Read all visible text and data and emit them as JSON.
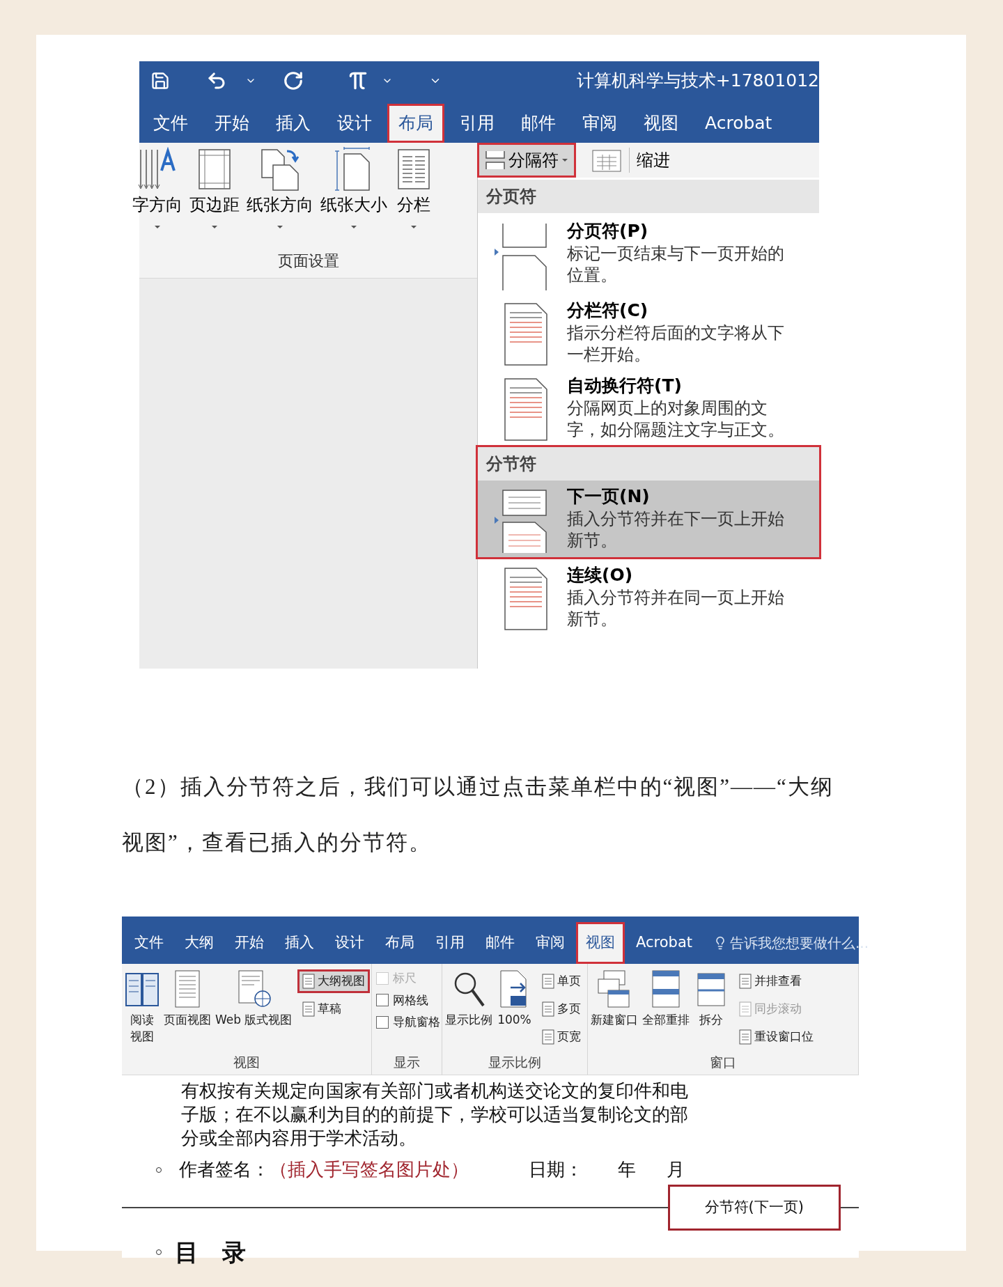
{
  "top_screenshot": {
    "title": "计算机科学与技术+17801012",
    "tabs": [
      {
        "label": "文件",
        "selected": false,
        "highlighted": false
      },
      {
        "label": "开始",
        "selected": false,
        "highlighted": false
      },
      {
        "label": "插入",
        "selected": false,
        "highlighted": false
      },
      {
        "label": "设计",
        "selected": false,
        "highlighted": false
      },
      {
        "label": "布局",
        "selected": true,
        "highlighted": true
      },
      {
        "label": "引用",
        "selected": false,
        "highlighted": false
      },
      {
        "label": "邮件",
        "selected": false,
        "highlighted": false
      },
      {
        "label": "审阅",
        "selected": false,
        "highlighted": false
      },
      {
        "label": "视图",
        "selected": false,
        "highlighted": false
      },
      {
        "label": "Acrobat",
        "selected": false,
        "highlighted": false
      }
    ],
    "page_setup": {
      "group_label": "页面设置",
      "buttons": [
        "字方向",
        "页边距",
        "纸张方向",
        "纸张大小",
        "分栏"
      ]
    },
    "breaks_button": {
      "label": "分隔符",
      "highlighted": true
    },
    "indent_label": "缩进",
    "breaks_menu": [
      {
        "heading": "分页符",
        "highlighted": false,
        "items": [
          {
            "title": "分页符(P)",
            "description": "标记一页结束与下一页开始的位置。",
            "selected": false,
            "highlighted": false
          },
          {
            "title": "分栏符(C)",
            "description": "指示分栏符后面的文字将从下一栏开始。",
            "selected": false,
            "highlighted": false
          },
          {
            "title": "自动换行符(T)",
            "description": "分隔网页上的对象周围的文字，如分隔题注文字与正文。",
            "selected": false,
            "highlighted": false
          }
        ]
      },
      {
        "heading": "分节符",
        "highlighted": true,
        "items": [
          {
            "title": "下一页(N)",
            "description": "插入分节符并在下一页上开始新节。",
            "selected": true,
            "highlighted": true
          },
          {
            "title": "连续(O)",
            "description": "插入分节符并在同一页上开始新节。",
            "selected": false,
            "highlighted": false
          }
        ]
      }
    ]
  },
  "instruction": "（2）插入分节符之后，我们可以通过点击菜单栏中的“视图”——“大纲视图”，查看已插入的分节符。",
  "bottom_screenshot": {
    "tabs": [
      {
        "label": "文件",
        "selected": false,
        "highlighted": false
      },
      {
        "label": "大纲",
        "selected": false,
        "highlighted": false
      },
      {
        "label": "开始",
        "selected": false,
        "highlighted": false
      },
      {
        "label": "插入",
        "selected": false,
        "highlighted": false
      },
      {
        "label": "设计",
        "selected": false,
        "highlighted": false
      },
      {
        "label": "布局",
        "selected": false,
        "highlighted": false
      },
      {
        "label": "引用",
        "selected": false,
        "highlighted": false
      },
      {
        "label": "邮件",
        "selected": false,
        "highlighted": false
      },
      {
        "label": "审阅",
        "selected": false,
        "highlighted": false
      },
      {
        "label": "视图",
        "selected": true,
        "highlighted": true
      },
      {
        "label": "Acrobat",
        "selected": false,
        "highlighted": false
      }
    ],
    "tell_me": "告诉我您想要做什么...",
    "groups": [
      {
        "label": "视图",
        "items": [
          {
            "kind": "large",
            "label": "阅读视图",
            "selected": false,
            "disabled": false
          },
          {
            "kind": "large",
            "label": "页面视图",
            "selected": false,
            "disabled": false
          },
          {
            "kind": "large",
            "label": "Web 版式视图",
            "selected": false,
            "disabled": false
          },
          {
            "kind": "small",
            "label": "大纲视图",
            "selected": true,
            "highlighted": true,
            "disabled": false
          },
          {
            "kind": "small",
            "label": "草稿",
            "selected": false,
            "highlighted": false,
            "disabled": false
          }
        ]
      },
      {
        "label": "显示",
        "items": [
          {
            "kind": "check",
            "label": "标尺",
            "checked": false,
            "disabled": true
          },
          {
            "kind": "check",
            "label": "网格线",
            "checked": false,
            "disabled": false
          },
          {
            "kind": "check",
            "label": "导航窗格",
            "checked": false,
            "disabled": false
          }
        ]
      },
      {
        "label": "显示比例",
        "items": [
          {
            "kind": "large",
            "label": "显示比例",
            "disabled": false
          },
          {
            "kind": "large",
            "label": "100%",
            "disabled": false
          },
          {
            "kind": "small",
            "label": "单页",
            "disabled": false
          },
          {
            "kind": "small",
            "label": "多页",
            "disabled": false
          },
          {
            "kind": "small",
            "label": "页宽",
            "disabled": false
          }
        ]
      },
      {
        "label": "窗口",
        "items": [
          {
            "kind": "large",
            "label": "新建窗口",
            "disabled": false
          },
          {
            "kind": "large",
            "label": "全部重排",
            "disabled": false
          },
          {
            "kind": "large",
            "label": "拆分",
            "disabled": false
          },
          {
            "kind": "small",
            "label": "并排查看",
            "disabled": false
          },
          {
            "kind": "small",
            "label": "同步滚动",
            "disabled": true
          },
          {
            "kind": "small",
            "label": "重设窗口位",
            "disabled": false
          }
        ]
      }
    ],
    "document": {
      "paragraph": "有权按有关规定向国家有关部门或者机构送交论文的复印件和电子版；在不以赢利为目的的前提下，学校可以适当复制论文的部分或全部内容用于学术活动。",
      "signature": {
        "label": "作者签名：",
        "note": "（插入手写签名图片处）",
        "date_label": "日期：",
        "year": "年",
        "month": "月"
      },
      "section_break": {
        "label": "分节符(下一页)",
        "highlighted": true
      },
      "heading": "目　录"
    }
  }
}
